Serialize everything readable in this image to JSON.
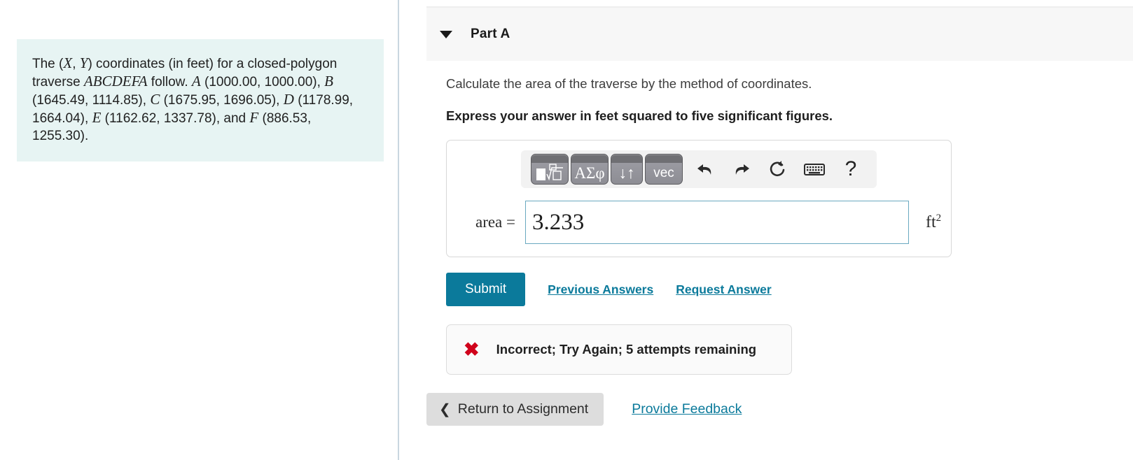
{
  "problem": {
    "line1_pre": "The (",
    "var_x": "X",
    "comma": ", ",
    "var_y": "Y",
    "line1_post": ") coordinates (in feet) for a closed-polygon traverse ",
    "traverse": "ABCDEFA",
    "follow": " follow. ",
    "points": [
      {
        "label": "A",
        "coords": " (1000.00, 1000.00), "
      },
      {
        "label": "B",
        "coords": " (1645.49, 1114.85), "
      },
      {
        "label": "C",
        "coords": " (1675.95, 1696.05), "
      },
      {
        "label": "D",
        "coords": " (1178.99, 1664.04), "
      },
      {
        "label": "E",
        "coords": " (1162.62, 1337.78), and "
      },
      {
        "label": "F",
        "coords": " (886.53, 1255.30)."
      }
    ]
  },
  "part": {
    "title": "Part A",
    "caret_icon": "triangle-down",
    "prompt": "Calculate the area of the traverse by the method of coordinates.",
    "prompt_bold": "Express your answer in feet squared to five significant figures."
  },
  "math_toolbar": {
    "buttons": [
      {
        "name": "template-root",
        "label": "",
        "icon": "box-nth-root-icon"
      },
      {
        "name": "greek-symbols",
        "label": "ΑΣφ",
        "icon": "greek-letters-icon"
      },
      {
        "name": "subscript-superscript",
        "label": "↓↑",
        "icon": "sub-superscript-icon"
      },
      {
        "name": "vector",
        "label": "vec",
        "icon": "vector-icon"
      }
    ],
    "icons": [
      {
        "name": "undo-icon",
        "glyph": "↰"
      },
      {
        "name": "redo-icon",
        "glyph": "↱"
      },
      {
        "name": "reset-icon",
        "glyph": "↻"
      },
      {
        "name": "keyboard-icon",
        "glyph": "⌨"
      },
      {
        "name": "help-icon",
        "glyph": "?"
      }
    ]
  },
  "answer": {
    "variable": "area =",
    "value": "3.233",
    "placeholder": "",
    "unit": "ft",
    "unit_exponent": "2"
  },
  "actions": {
    "submit_label": "Submit",
    "previous_answers_label": "Previous Answers",
    "request_answer_label": "Request Answer"
  },
  "feedback": {
    "icon": "red-x-icon",
    "text": "Incorrect; Try Again; 5 attempts remaining"
  },
  "footer": {
    "return_chevron": "❮",
    "return_label": "Return to Assignment",
    "provide_feedback_label": "Provide Feedback"
  },
  "colors": {
    "accent": "#0b7a9b",
    "problem_bg": "#e7f4f3",
    "error": "#d0021b",
    "input_border": "#6aa9c0"
  }
}
